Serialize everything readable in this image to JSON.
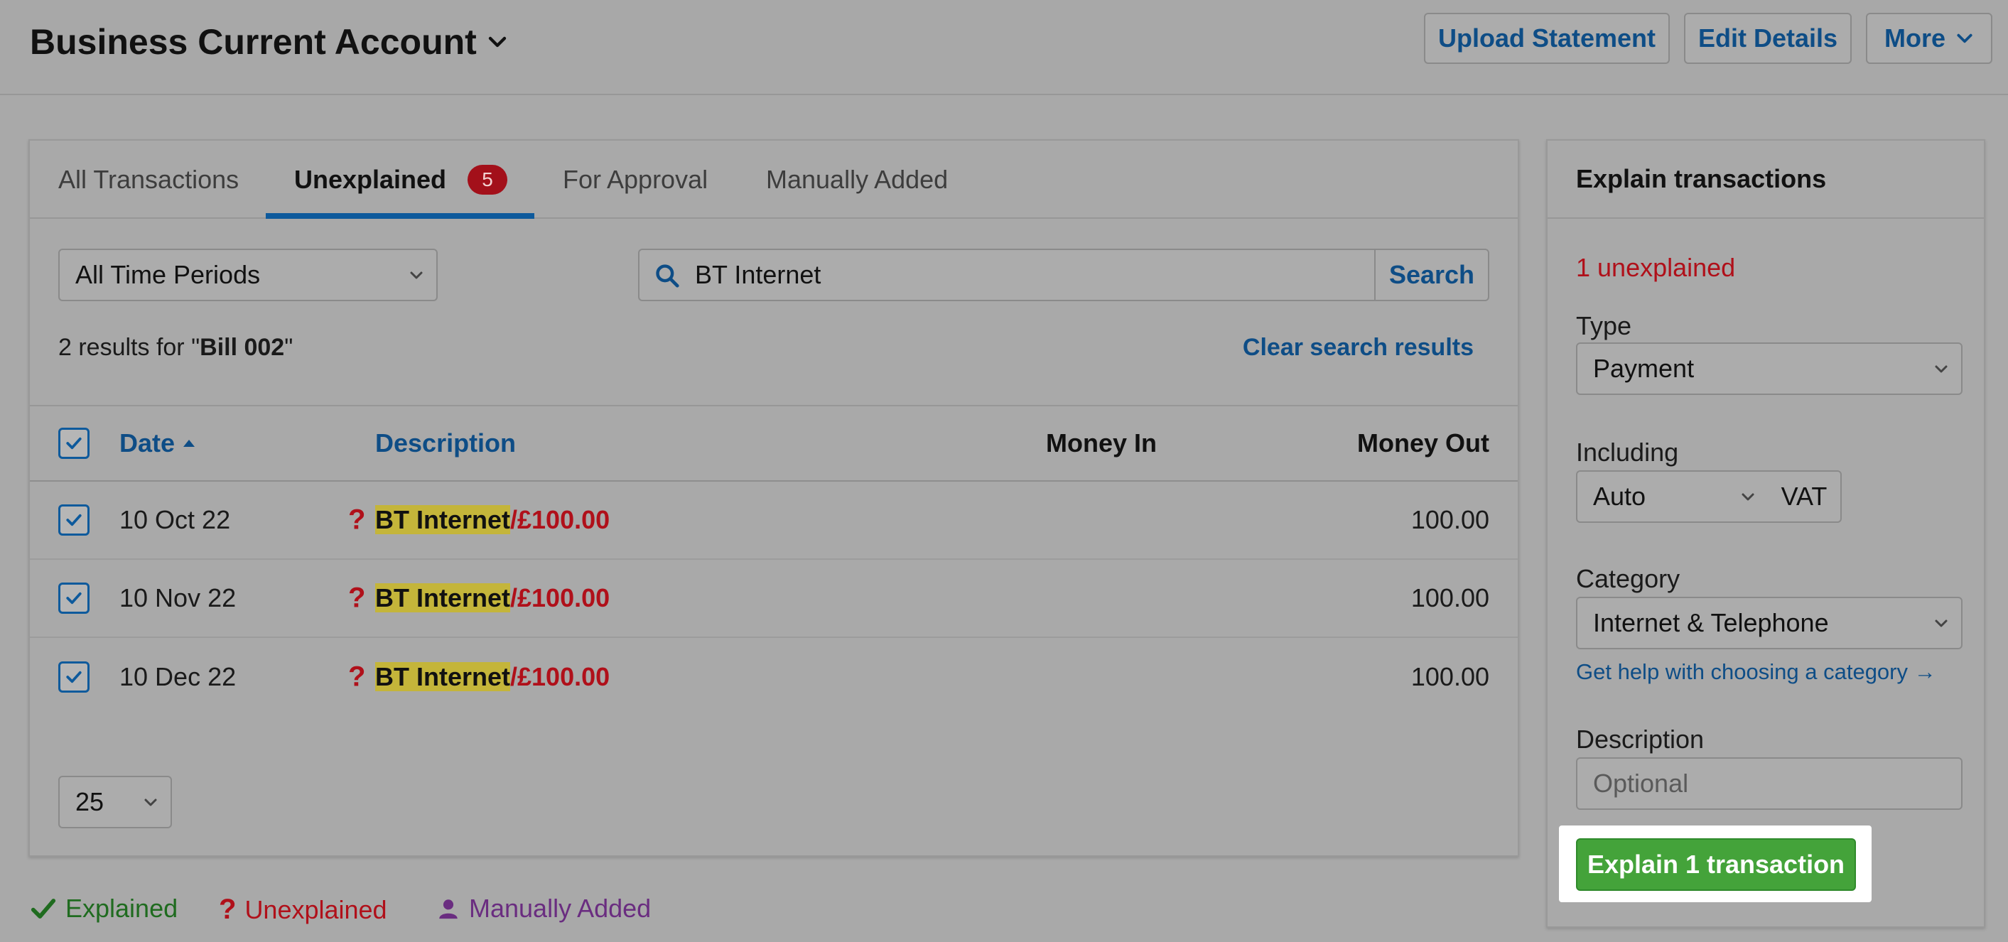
{
  "header": {
    "account_title": "Business Current Account",
    "upload_label": "Upload Statement",
    "edit_label": "Edit Details",
    "more_label": "More"
  },
  "tabs": [
    {
      "label": "All Transactions",
      "active": false
    },
    {
      "label": "Unexplained",
      "active": true,
      "badge": "5"
    },
    {
      "label": "For Approval",
      "active": false
    },
    {
      "label": "Manually Added",
      "active": false
    }
  ],
  "filters": {
    "period": "All Time Periods",
    "search_value": "BT Internet",
    "search_button": "Search"
  },
  "results": {
    "prefix": "2 results for \"",
    "query": "Bill 002",
    "suffix": "\"",
    "clear_label": "Clear search results"
  },
  "table": {
    "col_date": "Date",
    "col_description": "Description",
    "col_money_in": "Money In",
    "col_money_out": "Money Out",
    "rows": [
      {
        "date": "10 Oct 22",
        "status": "?",
        "payee": "BT Internet",
        "amount": "/£100.00",
        "money_out": "100.00"
      },
      {
        "date": "10 Nov 22",
        "status": "?",
        "payee": "BT Internet",
        "amount": "/£100.00",
        "money_out": "100.00"
      },
      {
        "date": "10 Dec 22",
        "status": "?",
        "payee": "BT Internet",
        "amount": "/£100.00",
        "money_out": "100.00"
      }
    ],
    "page_size": "25"
  },
  "legend": {
    "explained": "Explained",
    "unexplained": "Unexplained",
    "manually_added": "Manually Added"
  },
  "explain": {
    "title": "Explain transactions",
    "count_text": "1 unexplained",
    "type_label": "Type",
    "type_value": "Payment",
    "including_label": "Including",
    "including_value": "Auto",
    "vat_label": "VAT",
    "category_label": "Category",
    "category_value": "Internet & Telephone",
    "help_link": "Get help with choosing a category →",
    "description_label": "Description",
    "description_placeholder": "Optional",
    "submit_label": "Explain 1 transaction"
  },
  "colors": {
    "link_blue": "#0e4d86",
    "error_red": "#b0101a",
    "success_green": "#44a33a",
    "highlight_yellow": "#c4b53a",
    "manual_purple": "#6a2d80"
  }
}
